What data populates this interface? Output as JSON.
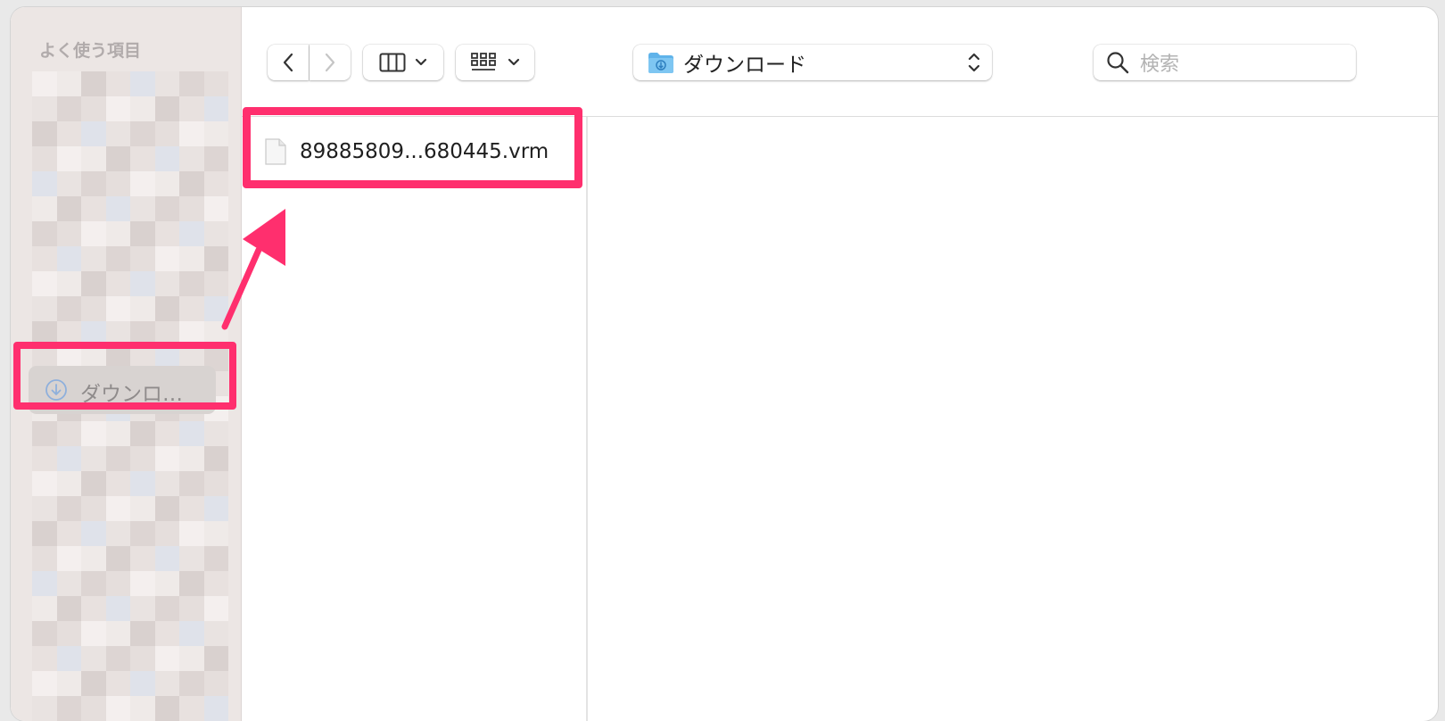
{
  "sidebar": {
    "heading": "よく使う項目",
    "selected_item": {
      "label": "ダウンロ…",
      "icon": "download-circle-icon"
    }
  },
  "toolbar": {
    "back_icon": "chevron-left-icon",
    "forward_icon": "chevron-right-icon",
    "view_mode_icon": "columns-view-icon",
    "group_icon": "grid-icon",
    "location": {
      "label": "ダウンロード",
      "icon": "downloads-folder-icon"
    },
    "search": {
      "placeholder": "検索",
      "icon": "search-icon"
    }
  },
  "files": [
    {
      "name": "89885809...680445.vrm",
      "icon": "document-icon"
    }
  ],
  "annotations": {
    "highlight_color": "#ff2f6e"
  }
}
